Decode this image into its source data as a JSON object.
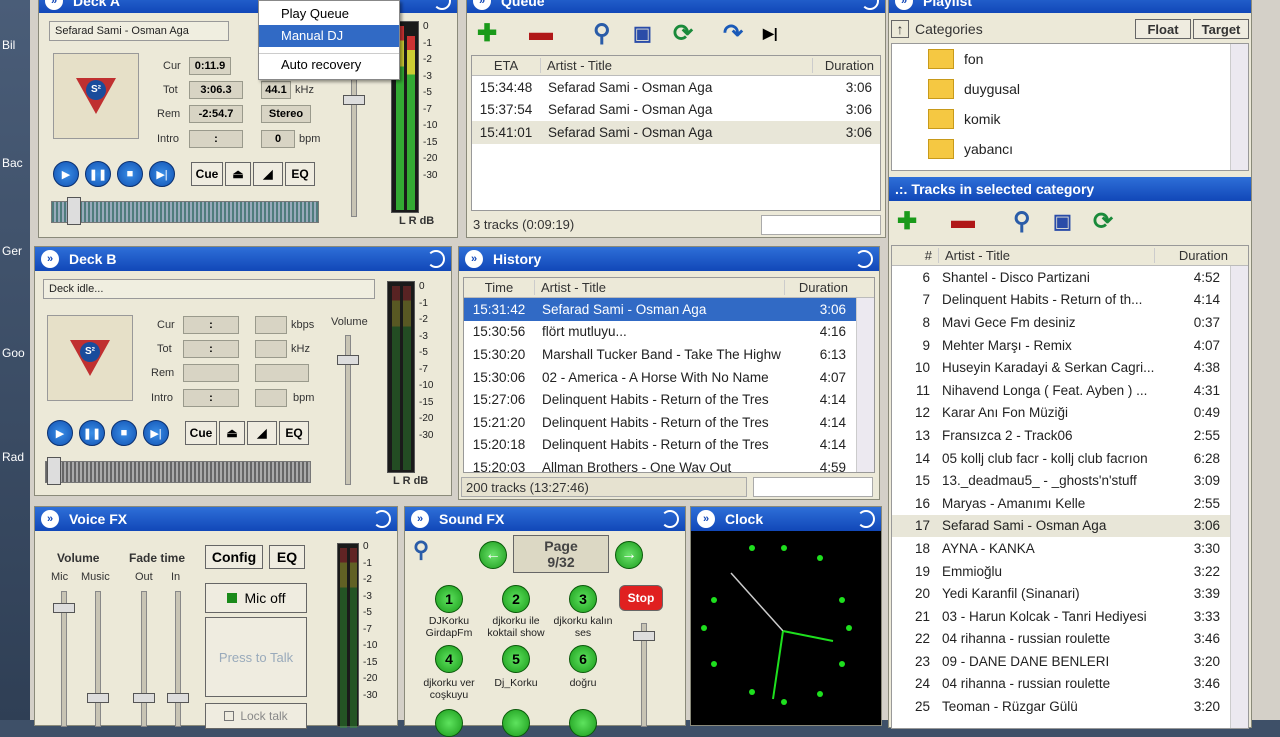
{
  "desktop": {
    "labels": [
      "Bil",
      "Bac",
      "Ger",
      "Goo",
      "Rad"
    ]
  },
  "context_menu": {
    "items": [
      "Play Queue",
      "Manual DJ",
      "Auto recovery"
    ]
  },
  "deckA": {
    "title": "Deck A",
    "track": "Sefarad Sami - Osman Aga",
    "cur_label": "Cur",
    "cur": "0:11.9",
    "tot_label": "Tot",
    "tot": "3:06.3",
    "rem_label": "Rem",
    "rem": "-2:54.7",
    "intro_label": "Intro",
    "intro": ":",
    "khz": "44.1",
    "khz_unit": "kHz",
    "mode": "Stereo",
    "bpm": "0",
    "bpm_unit": "bpm",
    "cue": "Cue",
    "eq": "EQ",
    "lrdb": "L R dB"
  },
  "deckB": {
    "title": "Deck B",
    "status": "Deck idle...",
    "cur_label": "Cur",
    "cur": ":",
    "tot_label": "Tot",
    "tot": ":",
    "rem_label": "Rem",
    "intro_label": "Intro",
    "intro": ":",
    "kbps": "kbps",
    "khz": "kHz",
    "bpm": "bpm",
    "volume": "Volume",
    "cue": "Cue",
    "eq": "EQ",
    "lrdb": "L R dB"
  },
  "meter_scale": [
    "0",
    "-1",
    "-2",
    "-3",
    "-5",
    "-7",
    "-10",
    "-15",
    "-20",
    "-30"
  ],
  "queue": {
    "title": "Queue",
    "col_eta": "ETA",
    "col_title": "Artist - Title",
    "col_dur": "Duration",
    "rows": [
      [
        "15:34:48",
        "Sefarad Sami - Osman Aga",
        "3:06"
      ],
      [
        "15:37:54",
        "Sefarad Sami - Osman Aga",
        "3:06"
      ],
      [
        "15:41:01",
        "Sefarad Sami - Osman Aga",
        "3:06"
      ]
    ],
    "status": "3 tracks (0:09:19)"
  },
  "history": {
    "title": "History",
    "col_time": "Time",
    "col_title": "Artist - Title",
    "col_dur": "Duration",
    "rows": [
      [
        "15:31:42",
        "Sefarad Sami - Osman Aga",
        "3:06"
      ],
      [
        "15:30:56",
        "flört mutluyu...",
        "4:16"
      ],
      [
        "15:30:20",
        "Marshall Tucker Band - Take The Highw",
        "6:13"
      ],
      [
        "15:30:06",
        "02 - America - A Horse With No Name",
        "4:07"
      ],
      [
        "15:27:06",
        "Delinquent Habits - Return of the Tres",
        "4:14"
      ],
      [
        "15:21:20",
        "Delinquent Habits - Return of the Tres",
        "4:14"
      ],
      [
        "15:20:18",
        "Delinquent Habits - Return of the Tres",
        "4:14"
      ],
      [
        "15:20:03",
        "Allman Brothers - One Way Out",
        "4:59"
      ]
    ],
    "status": "200 tracks (13:27:46)"
  },
  "playlist": {
    "title": "Playlist",
    "categories": "Categories",
    "float": "Float",
    "target": "Target",
    "folders": [
      "fon",
      "duygusal",
      "komik",
      "yabancı"
    ],
    "tracks_title": ".:. Tracks in selected category",
    "col_num": "#",
    "col_title": "Artist - Title",
    "col_dur": "Duration",
    "rows": [
      [
        "6",
        "Shantel - Disco Partizani",
        "4:52"
      ],
      [
        "7",
        "Delinquent Habits - Return of th...",
        "4:14"
      ],
      [
        "8",
        "Mavi Gece Fm desiniz",
        "0:37"
      ],
      [
        "9",
        "Mehter Marşı - Remix",
        "4:07"
      ],
      [
        "10",
        "Huseyin Karadayi & Serkan Cagri...",
        "4:38"
      ],
      [
        "11",
        "Nihavend Longa ( Feat. Ayben ) ...",
        "4:31"
      ],
      [
        "12",
        "Karar Anı Fon Müziği",
        "0:49"
      ],
      [
        "13",
        "Fransızca 2 - Track06",
        "2:55"
      ],
      [
        "14",
        "05 kollj club facr - kollj club facrıon",
        "6:28"
      ],
      [
        "15",
        "13._deadmau5_ - _ghosts'n'stuff",
        "3:09"
      ],
      [
        "16",
        "Maryas - Amanımı Kelle",
        "2:55"
      ],
      [
        "17",
        "Sefarad Sami - Osman Aga",
        "3:06"
      ],
      [
        "18",
        "AYNA - KANKA",
        "3:30"
      ],
      [
        "19",
        "Emmioğlu",
        "3:22"
      ],
      [
        "20",
        "Yedi Karanfil (Sinanari)",
        "3:39"
      ],
      [
        "21",
        "03 - Harun Kolcak - Tanri Hediyesi",
        "3:33"
      ],
      [
        "22",
        "04 rihanna - russian roulette",
        "3:46"
      ],
      [
        "23",
        "09 - DANE DANE BENLERI",
        "3:20"
      ],
      [
        "24",
        "04 rihanna - russian roulette",
        "3:46"
      ],
      [
        "25",
        "Teoman - Rüzgar Gülü",
        "3:20"
      ]
    ]
  },
  "voicefx": {
    "title": "Voice FX",
    "volume": "Volume",
    "fade": "Fade time",
    "mic": "Mic",
    "music": "Music",
    "out": "Out",
    "in": "In",
    "config": "Config",
    "eq": "EQ",
    "micoff": "Mic off",
    "talk": "Press to Talk",
    "lock": "Lock talk"
  },
  "soundfx": {
    "title": "Sound FX",
    "page": "Page",
    "page_num": "9/32",
    "stop": "Stop",
    "buttons": [
      [
        "1",
        "DJKorku GirdapFm"
      ],
      [
        "2",
        "djkorku ile koktail show"
      ],
      [
        "3",
        "djkorku kalın ses"
      ],
      [
        "4",
        "djkorku ver coşkuyu"
      ],
      [
        "5",
        "Dj_Korku"
      ],
      [
        "6",
        "doğru"
      ]
    ]
  },
  "clock": {
    "title": "Clock"
  }
}
